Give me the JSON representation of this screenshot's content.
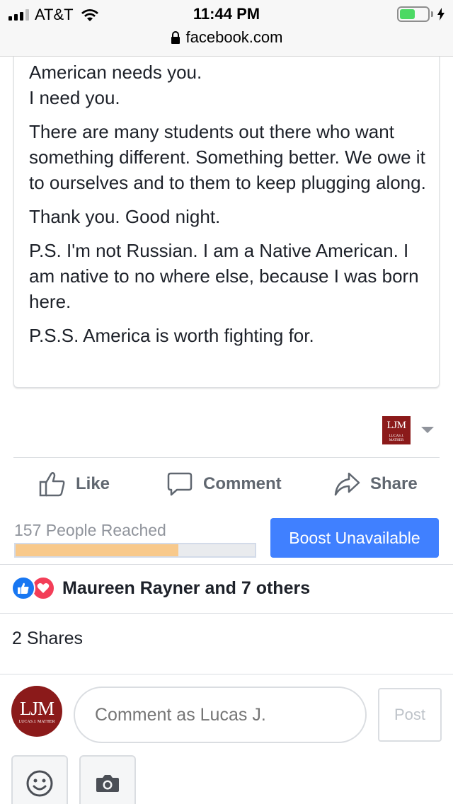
{
  "status_bar": {
    "carrier": "AT&T",
    "time": "11:44 PM",
    "url": "facebook.com",
    "battery_level": 0.55
  },
  "post": {
    "body_lines": [
      "American needs you.",
      "I need you.",
      "There are many students out there who want something different. Something better. We owe it to ourselves and to them to keep plugging along.",
      "Thank you. Good night.",
      "P.S. I'm not Russian. I am a Native American. I am native to no where else, because I was born here.",
      "P.S.S. America is worth fighting for."
    ],
    "page_avatar": {
      "monogram": "LJM",
      "subtitle": "LUCAS J. MATHER"
    }
  },
  "actions": {
    "like_label": "Like",
    "comment_label": "Comment",
    "share_label": "Share"
  },
  "insights": {
    "reached_text": "157 People Reached",
    "reach_progress": 0.68,
    "boost_label": "Boost Unavailable"
  },
  "reactions": {
    "summary": "Maureen Rayner and 7 others",
    "icons": [
      "like-icon",
      "love-icon"
    ]
  },
  "shares_text": "2 Shares",
  "composer": {
    "avatar_monogram": "LJM",
    "avatar_subtitle": "LUCAS J. MATHER",
    "placeholder": "Comment as Lucas J.",
    "post_label": "Post",
    "tools": [
      "emoji-icon",
      "camera-icon"
    ]
  },
  "colors": {
    "brand_blue": "#4080ff",
    "like_blue": "#1877f2",
    "love_red": "#f33e58",
    "reach_fill": "#f8c98b",
    "avatar_red": "#8b1a1a"
  }
}
